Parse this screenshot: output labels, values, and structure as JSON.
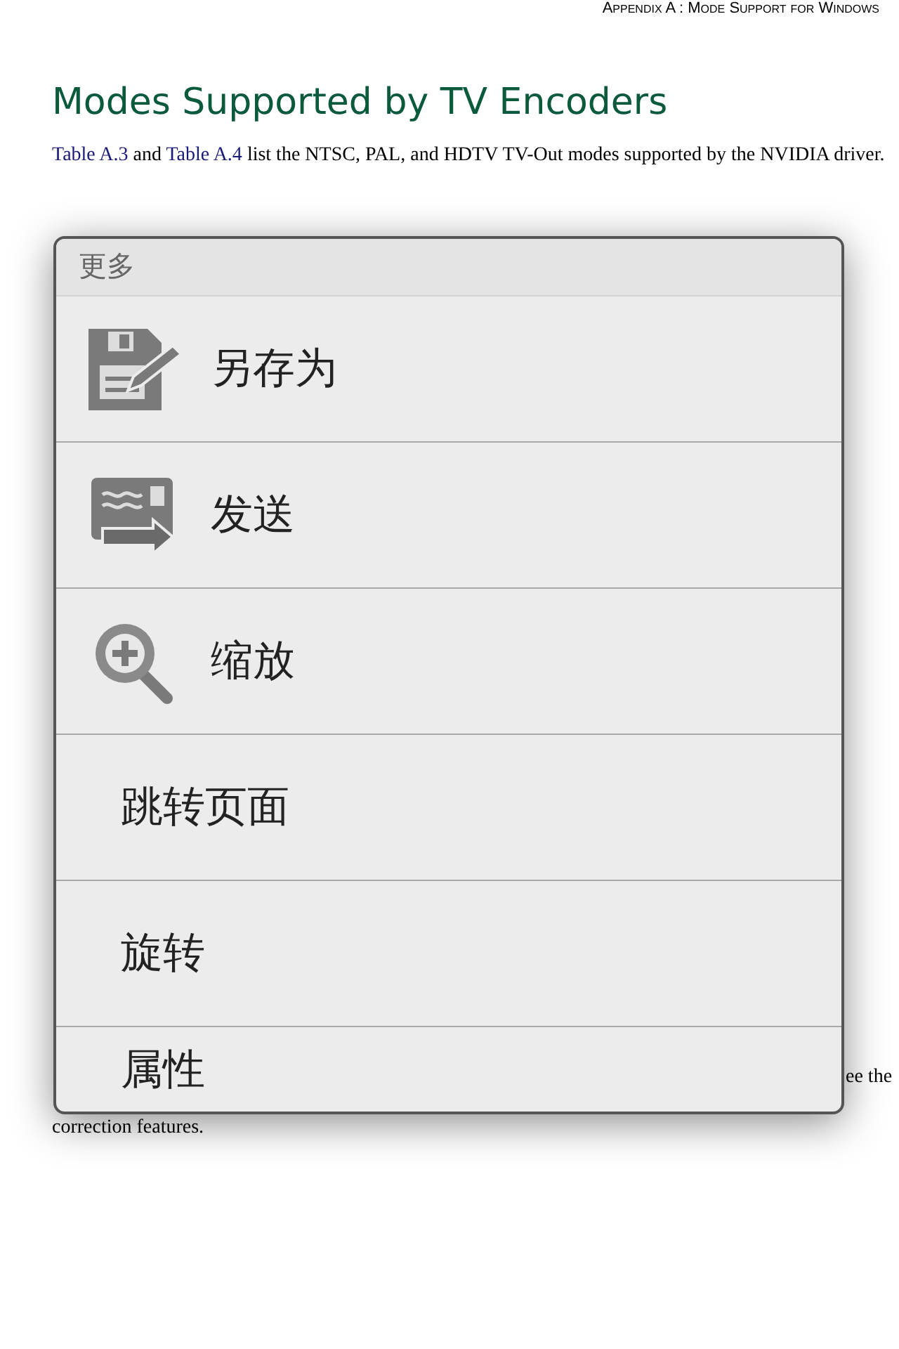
{
  "page": {
    "running_header": "Appendix A : Mode Support for Windows",
    "title": "Modes Supported by TV Encoders",
    "intro": [
      {
        "kind": "link",
        "text": "Table A.3"
      },
      {
        "kind": "plain",
        "text": " and "
      },
      {
        "kind": "link",
        "text": "Table A.4"
      },
      {
        "kind": "plain",
        "text": " list the NTSC, PAL, and HDTV TV-Out modes supported by the NVIDIA driver."
      }
    ],
    "fragment": "ee the",
    "closing": "correction features."
  },
  "menu": {
    "title": "更多",
    "items": [
      {
        "kind": "save",
        "label": "另存为"
      },
      {
        "kind": "send",
        "label": "发送"
      },
      {
        "kind": "zoom",
        "label": "缩放"
      },
      {
        "kind": "text",
        "label": "跳转页面"
      },
      {
        "kind": "text",
        "label": "旋转"
      },
      {
        "kind": "text",
        "label": "属性"
      }
    ]
  }
}
